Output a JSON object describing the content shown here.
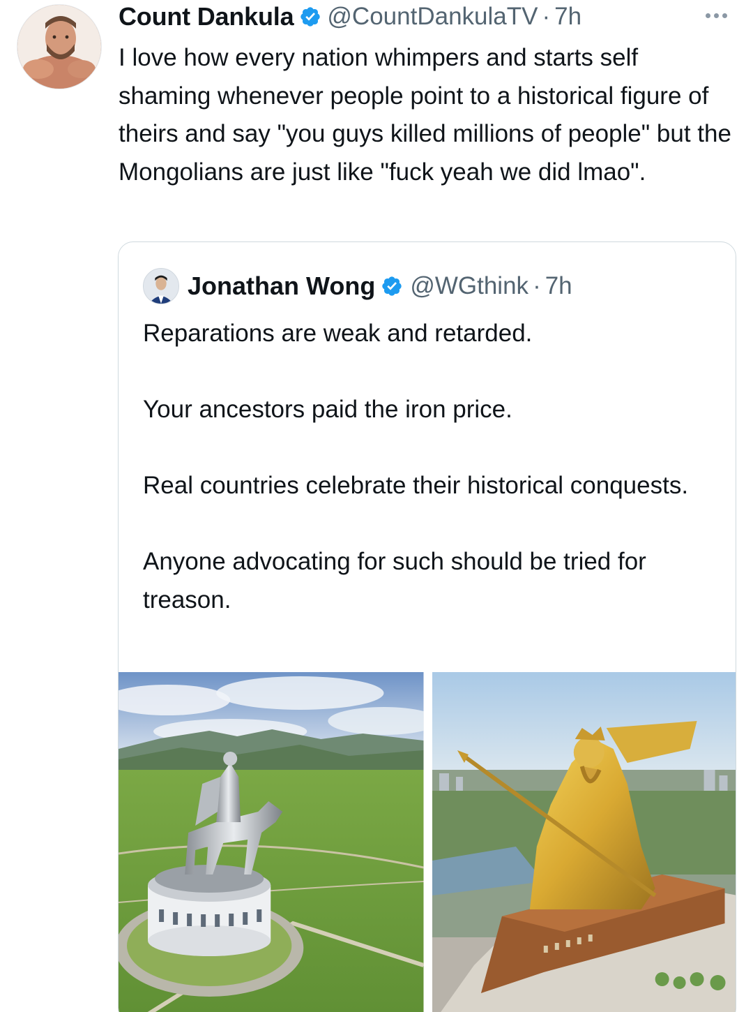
{
  "tweet": {
    "author": {
      "display_name": "Count Dankula",
      "handle": "@CountDankulaTV",
      "verified": true
    },
    "time": "7h",
    "separator": "·",
    "text": "I love how every nation whimpers and starts self shaming whenever people point to a historical figure of theirs and say \"you guys killed millions of people\" but the Mongolians are just like \"fuck yeah we did lmao\".",
    "more_icon": "ellipsis-icon"
  },
  "quote": {
    "author": {
      "display_name": "Jonathan Wong",
      "handle": "@WGthink",
      "verified": true
    },
    "time": "7h",
    "separator": "·",
    "paragraphs": [
      "Reparations are weak and retarded.",
      "Your ancestors paid the iron price.",
      "Real countries celebrate their historical conquests.",
      "Anyone advocating for such should be tried for treason."
    ],
    "media": [
      {
        "kind": "photo",
        "subject": "silver equestrian statue on round base in green steppe"
      },
      {
        "kind": "photo",
        "subject": "golden warrior statue on large bronze building"
      }
    ]
  },
  "colors": {
    "text": "#0f1419",
    "secondary": "#536471",
    "verified": "#1d9bf0",
    "border": "#cfd9de"
  }
}
